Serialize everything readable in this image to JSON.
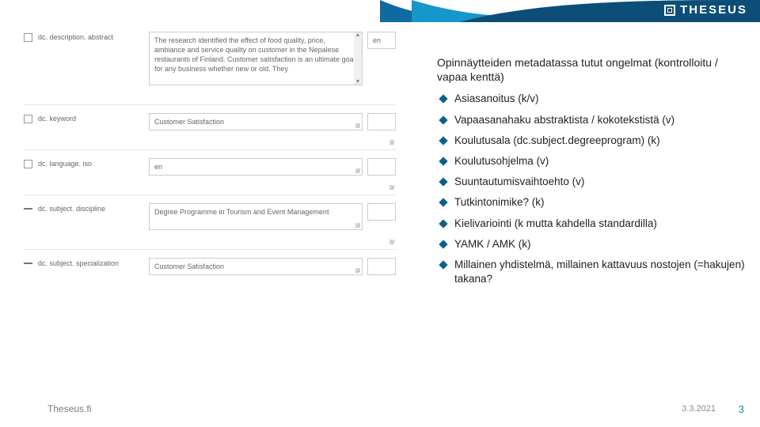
{
  "brand": {
    "name": "THESEUS"
  },
  "content": {
    "heading": "Opinnäytteiden metadatassa tutut ongelmat (kontrolloitu / vapaa kenttä)",
    "bullets": [
      "Asiasanoitus (k/v)",
      "Vapaasanahaku abstraktista / kokotekstistä (v)",
      "Koulutusala (dc.subject.degreeprogram) (k)",
      "Koulutusohjelma (v)",
      "Suuntautumisvaihtoehto (v)",
      "Tutkintonimike? (k)",
      "Kielivariointi (k mutta kahdella standardilla)",
      "YAMK / AMK (k)",
      "Millainen yhdistelmä, millainen kattavuus nostojen (=hakujen) takana?"
    ]
  },
  "form": {
    "rows": {
      "abstract": {
        "label": "dc. description. abstract",
        "value": "The research identified the effect of food quality, price, ambiance and service quality on customer in the Nepalese restaurants of Finland. Customer satisfaction is an ultimate goal for any business whether new or old. They",
        "lang": "en"
      },
      "keyword": {
        "label": "dc. keyword",
        "value": "Customer Satisfaction"
      },
      "language": {
        "label": "dc. language. iso",
        "value": "en"
      },
      "discipline": {
        "label": "dc. subject. discipline",
        "value": "Degree Programme in Tourism and Event Management"
      },
      "specialization": {
        "label": "dc. subject. specialization",
        "value": "Customer Satisfaction"
      }
    }
  },
  "footer": {
    "site": "Theseus.fi",
    "date": "3.3.2021",
    "page": "3"
  }
}
